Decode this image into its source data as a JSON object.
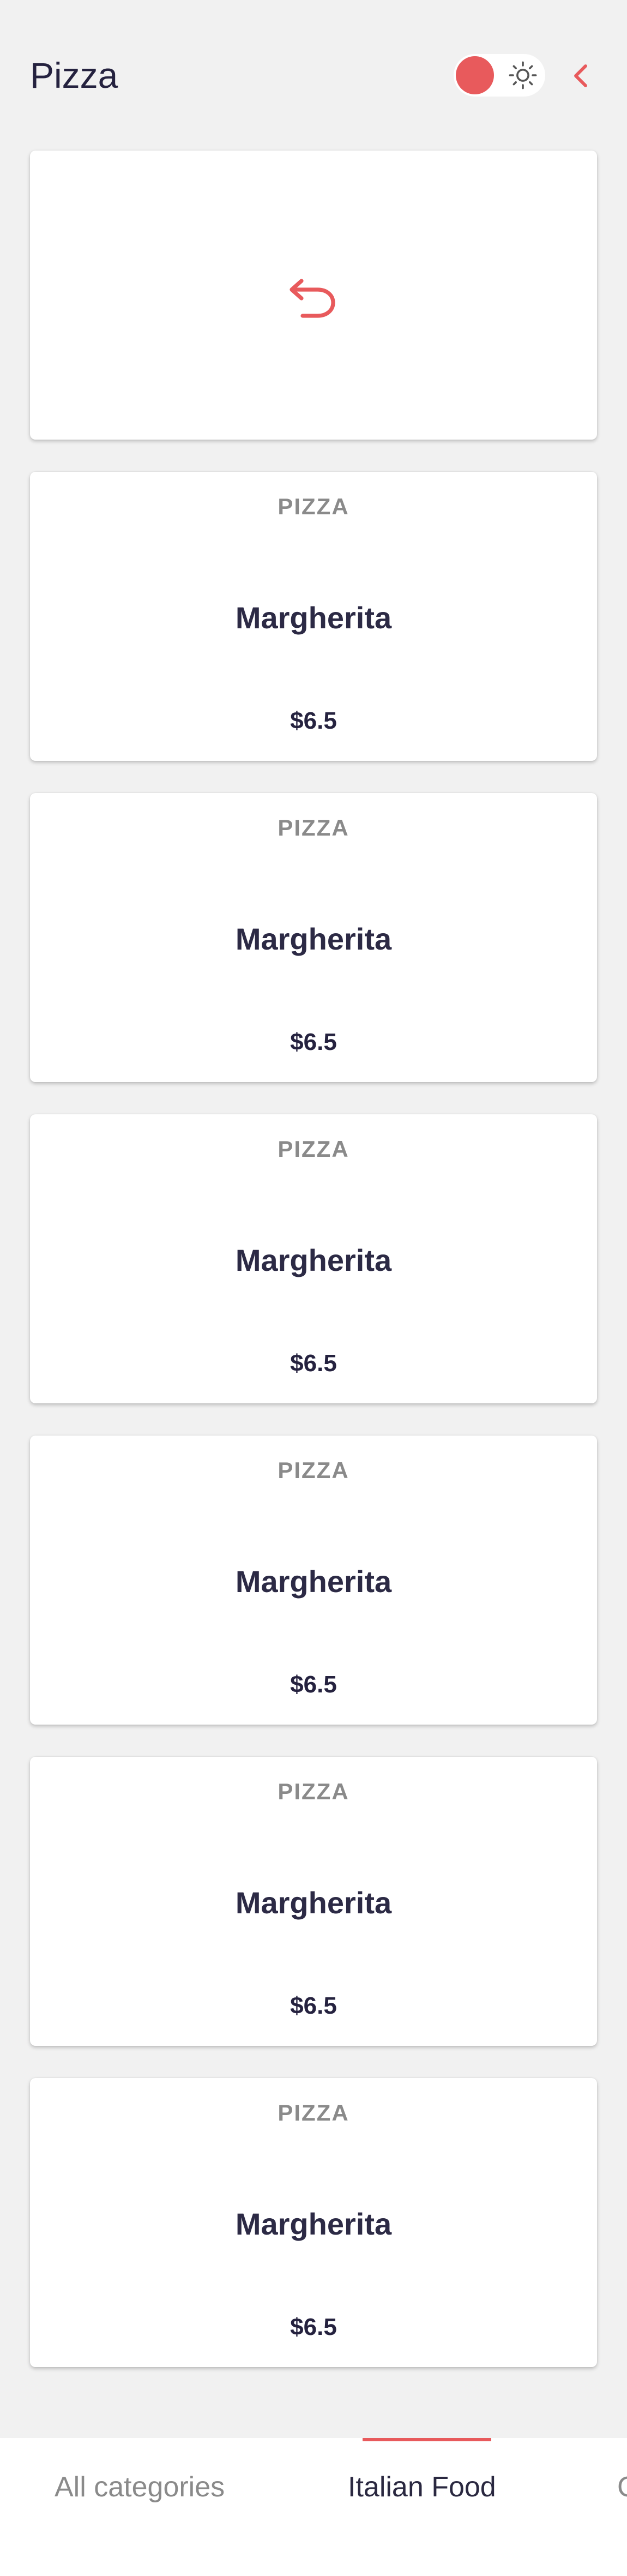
{
  "header": {
    "title": "Pizza"
  },
  "theme_toggle": {
    "knob_color": "#e85a5c",
    "icon": "sun-icon"
  },
  "back_icon": "chevron-left-icon",
  "reload_card": {
    "icon": "undo-icon",
    "icon_color": "#e85a5c"
  },
  "products": [
    {
      "category": "PIZZA",
      "name": "Margherita",
      "price": "$6.5"
    },
    {
      "category": "PIZZA",
      "name": "Margherita",
      "price": "$6.5"
    },
    {
      "category": "PIZZA",
      "name": "Margherita",
      "price": "$6.5"
    },
    {
      "category": "PIZZA",
      "name": "Margherita",
      "price": "$6.5"
    },
    {
      "category": "PIZZA",
      "name": "Margherita",
      "price": "$6.5"
    },
    {
      "category": "PIZZA",
      "name": "Margherita",
      "price": "$6.5"
    }
  ],
  "tabs": [
    {
      "label": "All categories",
      "active": false
    },
    {
      "label": "Italian Food",
      "active": true
    },
    {
      "label": "C",
      "active": false
    }
  ],
  "colors": {
    "accent": "#e85a5c",
    "background": "#f1f1f1",
    "title": "#25223f"
  }
}
